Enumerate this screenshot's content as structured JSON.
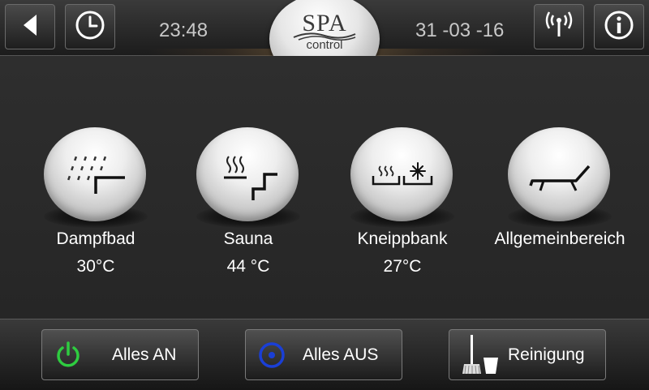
{
  "header": {
    "time": "23:48",
    "date": "31 -03 -16",
    "logo": {
      "brand": "SPA",
      "subtitle": "control"
    },
    "icons": [
      "back-arrow-icon",
      "clock-icon",
      "wireless-signal-icon",
      "info-icon"
    ]
  },
  "rooms": [
    {
      "id": "dampfbad",
      "label": "Dampfbad",
      "value": "30°C",
      "icon": "steam-bath-icon"
    },
    {
      "id": "sauna",
      "label": "Sauna",
      "value": "44 °C",
      "icon": "sauna-icon"
    },
    {
      "id": "kneippbank",
      "label": "Kneippbank",
      "value": "27°C",
      "icon": "kneipp-bench-icon"
    },
    {
      "id": "allgemeinbereich",
      "label": "Allgemeinbereich",
      "value": "",
      "icon": "lounger-icon"
    }
  ],
  "footer": {
    "all_on_label": "Alles AN",
    "all_off_label": "Alles AUS",
    "cleaning_label": "Reinigung"
  },
  "colors": {
    "power_green": "#2ecc40",
    "off_blue": "#1a3fd6"
  }
}
